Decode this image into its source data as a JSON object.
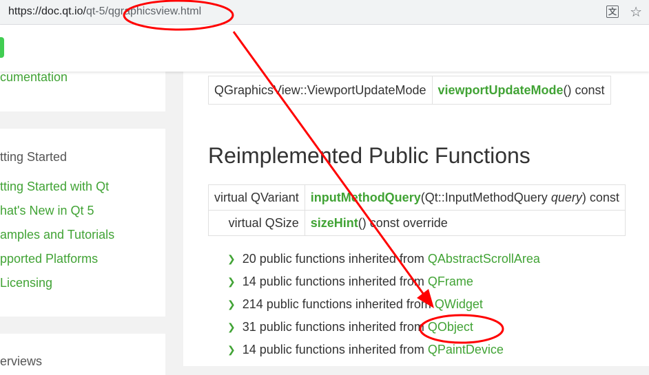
{
  "browser": {
    "url_host": "https://doc.qt.io/",
    "url_rest": "qt-5/qgraphicsview.html",
    "translate_glyph": "文"
  },
  "sidebar": {
    "card1_link": "cumentation",
    "card2": {
      "heading": "tting Started",
      "links": [
        "tting Started with Qt",
        "hat's New in Qt 5",
        "amples and Tutorials",
        "pported Platforms",
        "Licensing"
      ]
    },
    "card3_heading": "erviews"
  },
  "content": {
    "top_row": {
      "type": "QGraphicsView::ViewportUpdateMode",
      "fn_name": "viewportUpdateMode",
      "fn_suffix": "() const"
    },
    "section_title": "Reimplemented Public Functions",
    "reimplemented": [
      {
        "type": "virtual QVariant",
        "fn_name": "inputMethodQuery",
        "fn_args_pre": "(Qt::InputMethodQuery ",
        "fn_args_param": "query",
        "fn_args_post": ") const"
      },
      {
        "type": "virtual QSize",
        "fn_name": "sizeHint",
        "fn_suffix": "() const override"
      }
    ],
    "inherited": [
      {
        "text": "20 public functions inherited from ",
        "link": "QAbstractScrollArea"
      },
      {
        "text": "14 public functions inherited from ",
        "link": "QFrame"
      },
      {
        "text": "214 public functions inherited from ",
        "link": "QWidget"
      },
      {
        "text": "31 public functions inherited from ",
        "link": "QObject"
      },
      {
        "text": "14 public functions inherited from ",
        "link": "QPaintDevice"
      }
    ]
  },
  "colors": {
    "qt_green": "#41cd52",
    "link_green": "#41a335",
    "annotation_red": "#ff0000"
  },
  "icons": [
    "translate-icon",
    "star-icon",
    "chevron-right-icon"
  ]
}
